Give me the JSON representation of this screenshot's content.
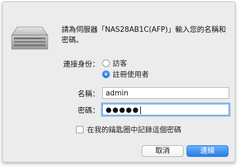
{
  "dialog": {
    "prompt": "請為伺服器「NAS28AB1C(AFP)」輸入您的名稱和密碼。",
    "connect_as_label": "連接身份：",
    "guest_label": "訪客",
    "registered_user_label": "註冊使用者",
    "selected_option": "registered_user",
    "name_label": "名稱：",
    "name_value": "admin",
    "password_label": "密碼：",
    "password_dots": "●●●●●",
    "keychain_label": "在我的鑰匙圈中記錄這個密碼",
    "keychain_checked": false,
    "cancel_label": "取消",
    "connect_label": "連線"
  },
  "icons": {
    "server": "server-icon"
  },
  "colors": {
    "accent": "#2a7ee9",
    "dialog_bg": "#ececec",
    "focus_ring": "#5b9dea"
  }
}
